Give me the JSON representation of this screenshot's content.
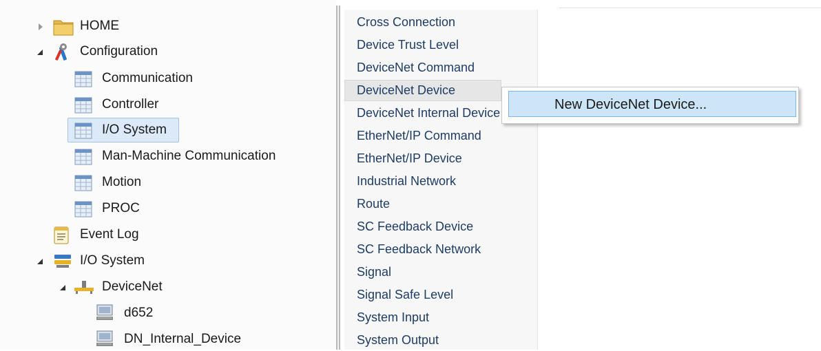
{
  "tree": {
    "home": "HOME",
    "configuration": "Configuration",
    "communication": "Communication",
    "controller": "Controller",
    "io_system_config": "I/O System",
    "man_machine": "Man-Machine Communication",
    "motion": "Motion",
    "proc": "PROC",
    "event_log": "Event Log",
    "io_system": "I/O System",
    "devicenet": "DeviceNet",
    "device_d652": "d652",
    "device_internal": "DN_Internal_Device"
  },
  "types_list": {
    "items": [
      "Cross Connection",
      "Device Trust Level",
      "DeviceNet Command",
      "DeviceNet Device",
      "DeviceNet Internal Device",
      "EtherNet/IP Command",
      "EtherNet/IP Device",
      "Industrial Network",
      "Route",
      "SC Feedback Device",
      "SC Feedback Network",
      "Signal",
      "Signal Safe Level",
      "System Input",
      "System Output"
    ],
    "hovered_item": "DeviceNet Device"
  },
  "context_menu": {
    "new_devicenet_device": "New DeviceNet Device..."
  },
  "colors": {
    "selection_bg": "#dbe9f9",
    "menu_highlight": "#cde6f7",
    "list_text": "#1e3c64"
  },
  "icons": [
    "folder-icon",
    "configuration-tools-icon",
    "table-icon",
    "event-log-icon",
    "io-system-icon",
    "devicenet-icon",
    "device-icon"
  ]
}
